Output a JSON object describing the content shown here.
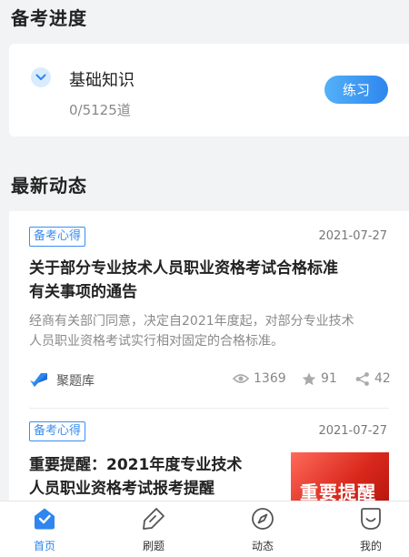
{
  "progress_section": {
    "title": "备考进度",
    "item_name": "基础知识",
    "count": "0/5125道",
    "practice_label": "练习"
  },
  "news_section": {
    "title": "最新动态"
  },
  "news": [
    {
      "tag": "备考心得",
      "date": "2021-07-27",
      "title_line1": "关于部分专业技术人员职业资格考试合格标准",
      "title_line2": "有关事项的通告",
      "excerpt_line1": "经商有关部门同意，决定自2021年度起，对部分专业技术",
      "excerpt_line2": "人员职业资格考试实行相对固定的合格标准。",
      "source": "聚题库",
      "views": "1369",
      "likes": "91",
      "shares": "42"
    },
    {
      "tag": "备考心得",
      "date": "2021-07-27",
      "title_line1": "重要提醒：2021年度专业技术",
      "title_line2": "人员职业资格考试报考提醒",
      "thumb_text": "重要提醒"
    }
  ],
  "tabbar": {
    "tabs": [
      {
        "label": "首页"
      },
      {
        "label": "刷题"
      },
      {
        "label": "动态"
      },
      {
        "label": "我的"
      }
    ]
  },
  "colors": {
    "accent": "#2e86ee",
    "tag": "#3a8ef0",
    "background": "#f2f3f5"
  }
}
